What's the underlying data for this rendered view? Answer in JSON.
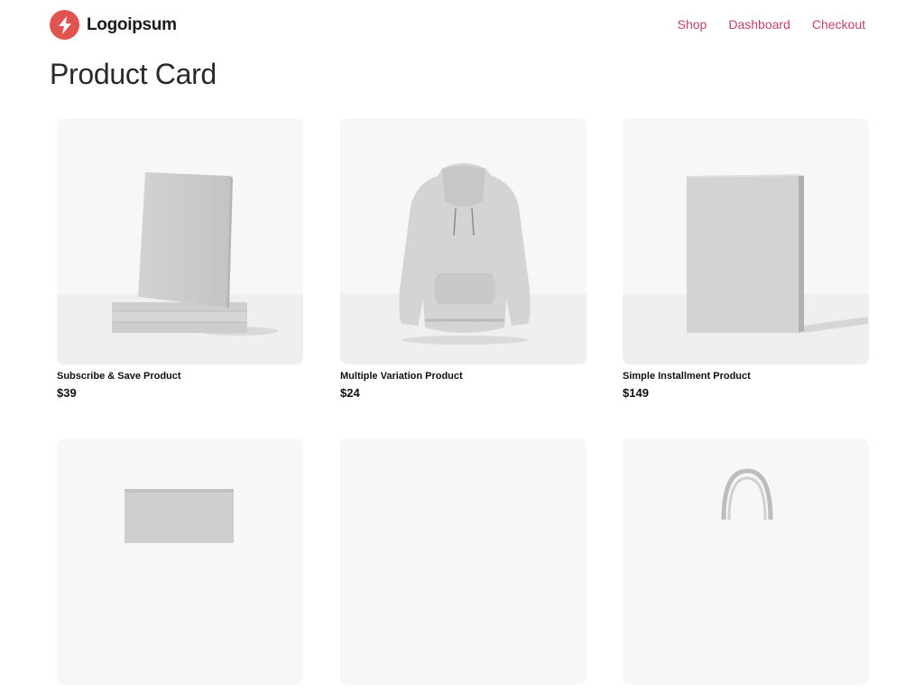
{
  "brand": {
    "name": "Logoipsum",
    "accent": "#e0544f"
  },
  "nav": {
    "links": [
      "Shop",
      "Dashboard",
      "Checkout"
    ],
    "link_color": "#c0436a"
  },
  "page": {
    "title": "Product Card"
  },
  "products": [
    {
      "name": "Subscribe & Save Product",
      "price": "$39",
      "image": "book-stack"
    },
    {
      "name": "Multiple Variation Product",
      "price": "$24",
      "image": "hoodie"
    },
    {
      "name": "Simple Installment Product",
      "price": "$149",
      "image": "box"
    },
    {
      "name": "",
      "price": "",
      "image": "envelope"
    },
    {
      "name": "",
      "price": "",
      "image": "blank"
    },
    {
      "name": "",
      "price": "",
      "image": "tote-bag"
    }
  ]
}
